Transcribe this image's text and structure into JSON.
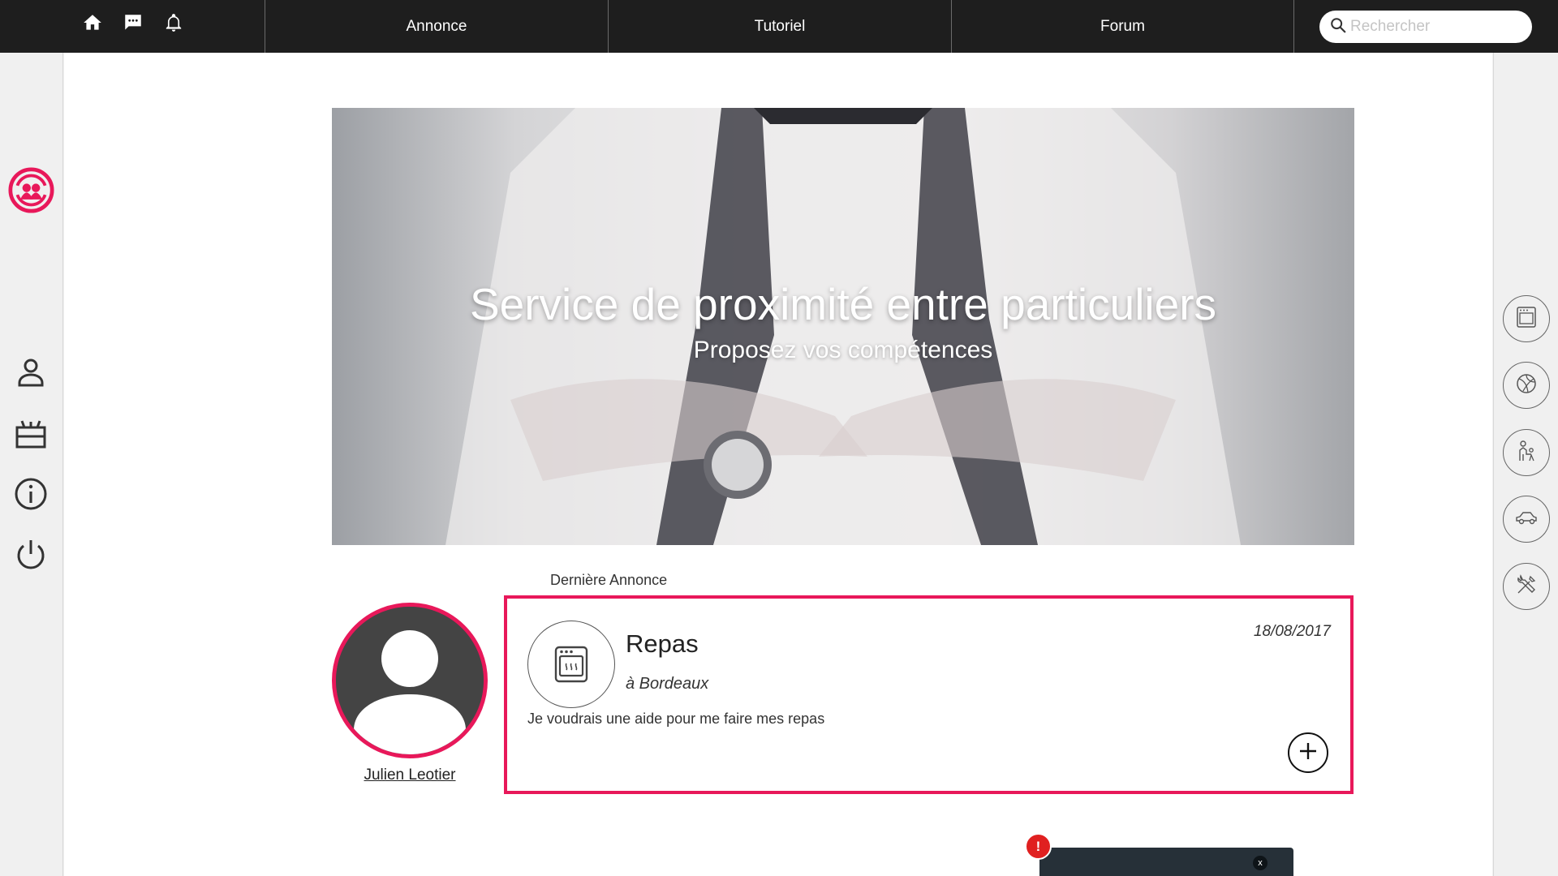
{
  "topbar": {
    "icons": [
      "home-icon",
      "chat-icon",
      "bell-icon"
    ],
    "nav": [
      "Annonce",
      "Tutoriel",
      "Forum"
    ],
    "search_placeholder": "Rechercher"
  },
  "sidebar_left": {
    "icons": [
      "logo-icon",
      "user-icon",
      "gift-icon",
      "info-icon",
      "power-icon"
    ]
  },
  "sidebar_right": {
    "categories": [
      "oven-icon",
      "ball-icon",
      "babysitting-icon",
      "car-icon",
      "tools-icon"
    ]
  },
  "hero": {
    "title": "Service de proximité entre particuliers",
    "subtitle": "Proposez vos compétences"
  },
  "latest": {
    "section_label": "Dernière Annonce",
    "user_name": "Julien Leotier",
    "title": "Repas",
    "city": "à Bordeaux",
    "date": "18/08/2017",
    "description": "Je voudrais une aide pour me faire mes repas"
  },
  "chat_widget": {
    "alert": "!",
    "close": "x"
  },
  "colors": {
    "accent": "#e8185a",
    "topbar": "#1e1e1e",
    "chat": "#263038"
  }
}
